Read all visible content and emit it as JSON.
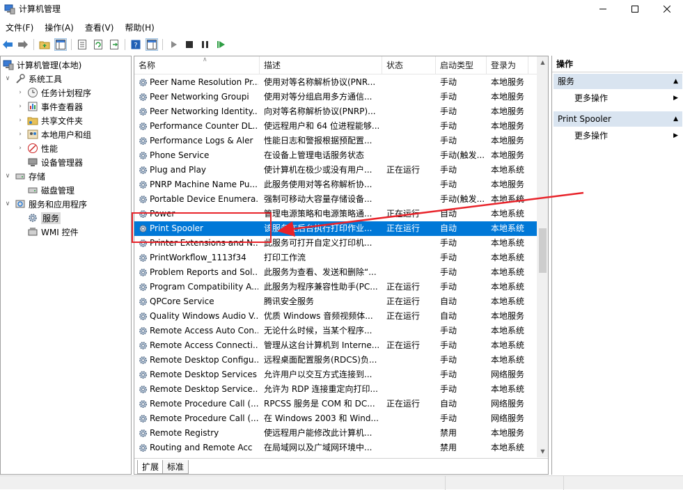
{
  "window": {
    "title": "计算机管理",
    "buttons": {
      "minimize": "minimize-icon",
      "maximize": "maximize-icon",
      "close": "close-icon"
    }
  },
  "menu": [
    "文件(F)",
    "操作(A)",
    "查看(V)",
    "帮助(H)"
  ],
  "toolbar": {
    "icons": [
      "back-arrow-icon",
      "forward-arrow-icon",
      "up-folder-icon",
      "show-hide-tree-icon",
      "properties-icon",
      "refresh-icon",
      "export-list-icon",
      "help-icon",
      "view-icon",
      "start-service-icon",
      "stop-service-icon",
      "pause-service-icon",
      "restart-service-icon"
    ]
  },
  "tree": {
    "items": [
      {
        "label": "计算机管理(本地)",
        "level": 0,
        "expander": "",
        "icon": "computer-management-icon"
      },
      {
        "label": "系统工具",
        "level": 1,
        "expander": "v",
        "icon": "system-tools-icon"
      },
      {
        "label": "任务计划程序",
        "level": 2,
        "expander": ">",
        "icon": "clock-icon"
      },
      {
        "label": "事件查看器",
        "level": 2,
        "expander": ">",
        "icon": "event-viewer-icon"
      },
      {
        "label": "共享文件夹",
        "level": 2,
        "expander": ">",
        "icon": "shared-folder-icon"
      },
      {
        "label": "本地用户和组",
        "level": 2,
        "expander": ">",
        "icon": "users-icon"
      },
      {
        "label": "性能",
        "level": 2,
        "expander": ">",
        "icon": "performance-icon"
      },
      {
        "label": "设备管理器",
        "level": 2,
        "expander": "",
        "icon": "device-manager-icon"
      },
      {
        "label": "存储",
        "level": 1,
        "expander": "v",
        "icon": "storage-icon"
      },
      {
        "label": "磁盘管理",
        "level": 2,
        "expander": "",
        "icon": "disk-icon"
      },
      {
        "label": "服务和应用程序",
        "level": 1,
        "expander": "v",
        "icon": "services-apps-icon"
      },
      {
        "label": "服务",
        "level": 2,
        "expander": "",
        "icon": "services-gear-icon",
        "selected": true
      },
      {
        "label": "WMI 控件",
        "level": 2,
        "expander": "",
        "icon": "wmi-icon"
      }
    ]
  },
  "list": {
    "columns": [
      "名称",
      "描述",
      "状态",
      "启动类型",
      "登录为"
    ],
    "rows": [
      {
        "name": "Peer Name Resolution Pr...",
        "desc": "使用对等名称解析协议(PNR...",
        "status": "",
        "startup": "手动",
        "logon": "本地服务"
      },
      {
        "name": "Peer Networking Groupi",
        "desc": "使用对等分组启用多方通信...",
        "status": "",
        "startup": "手动",
        "logon": "本地服务"
      },
      {
        "name": "Peer Networking Identity...",
        "desc": "向对等名称解析协议(PNRP)...",
        "status": "",
        "startup": "手动",
        "logon": "本地服务"
      },
      {
        "name": "Performance Counter DL...",
        "desc": "使远程用户和 64 位进程能够...",
        "status": "",
        "startup": "手动",
        "logon": "本地服务"
      },
      {
        "name": "Performance Logs & Aler",
        "desc": "性能日志和警报根据预配置...",
        "status": "",
        "startup": "手动",
        "logon": "本地服务"
      },
      {
        "name": "Phone Service",
        "desc": "在设备上管理电话服务状态",
        "status": "",
        "startup": "手动(触发...",
        "logon": "本地服务"
      },
      {
        "name": "Plug and Play",
        "desc": "使计算机在极少或没有用户...",
        "status": "正在运行",
        "startup": "手动",
        "logon": "本地系统"
      },
      {
        "name": "PNRP Machine Name Pu...",
        "desc": "此服务使用对等名称解析协...",
        "status": "",
        "startup": "手动",
        "logon": "本地服务"
      },
      {
        "name": "Portable Device Enumera...",
        "desc": "强制可移动大容量存储设备...",
        "status": "",
        "startup": "手动(触发...",
        "logon": "本地系统"
      },
      {
        "name": "Power",
        "desc": "管理电源策略和电源策略通...",
        "status": "正在运行",
        "startup": "自动",
        "logon": "本地系统"
      },
      {
        "name": "Print Spooler",
        "desc": "该服务在后台执行打印作业...",
        "status": "正在运行",
        "startup": "自动",
        "logon": "本地系统",
        "selected": true
      },
      {
        "name": "Printer Extensions and N...",
        "desc": "此服务可打开自定义打印机...",
        "status": "",
        "startup": "手动",
        "logon": "本地系统"
      },
      {
        "name": "PrintWorkflow_1113f34",
        "desc": "打印工作流",
        "status": "",
        "startup": "手动",
        "logon": "本地系统"
      },
      {
        "name": "Problem Reports and Sol...",
        "desc": "此服务为查看、发送和删除“...",
        "status": "",
        "startup": "手动",
        "logon": "本地系统"
      },
      {
        "name": "Program Compatibility A...",
        "desc": "此服务为程序兼容性助手(PC...",
        "status": "正在运行",
        "startup": "手动",
        "logon": "本地系统"
      },
      {
        "name": "QPCore Service",
        "desc": "腾讯安全服务",
        "status": "正在运行",
        "startup": "自动",
        "logon": "本地系统"
      },
      {
        "name": "Quality Windows Audio V...",
        "desc": "优质 Windows 音频视频体...",
        "status": "正在运行",
        "startup": "自动",
        "logon": "本地服务"
      },
      {
        "name": "Remote Access Auto Con...",
        "desc": "无论什么时候，当某个程序...",
        "status": "",
        "startup": "手动",
        "logon": "本地系统"
      },
      {
        "name": "Remote Access Connecti...",
        "desc": "管理从这台计算机到 Interne...",
        "status": "正在运行",
        "startup": "手动",
        "logon": "本地系统"
      },
      {
        "name": "Remote Desktop Configu...",
        "desc": "远程桌面配置服务(RDCS)负...",
        "status": "",
        "startup": "手动",
        "logon": "本地系统"
      },
      {
        "name": "Remote Desktop Services",
        "desc": "允许用户以交互方式连接到...",
        "status": "",
        "startup": "手动",
        "logon": "网络服务"
      },
      {
        "name": "Remote Desktop Service...",
        "desc": "允许为 RDP 连接重定向打印...",
        "status": "",
        "startup": "手动",
        "logon": "本地系统"
      },
      {
        "name": "Remote Procedure Call (...",
        "desc": "RPCSS 服务是 COM 和 DC...",
        "status": "正在运行",
        "startup": "自动",
        "logon": "网络服务"
      },
      {
        "name": "Remote Procedure Call (...",
        "desc": "在 Windows 2003 和 Wind...",
        "status": "",
        "startup": "手动",
        "logon": "网络服务"
      },
      {
        "name": "Remote Registry",
        "desc": "使远程用户能修改此计算机...",
        "status": "",
        "startup": "禁用",
        "logon": "本地服务"
      },
      {
        "name": "Routing and Remote Acc",
        "desc": "在局域网以及广域网环境中...",
        "status": "",
        "startup": "禁用",
        "logon": "本地系统"
      }
    ]
  },
  "tabs": [
    "扩展",
    "标准"
  ],
  "actions": {
    "title": "操作",
    "sections": [
      {
        "label": "服务",
        "items": [
          "更多操作"
        ]
      },
      {
        "label": "Print Spooler",
        "items": [
          "更多操作"
        ]
      }
    ]
  },
  "colors": {
    "selection": "#0078d7",
    "annotation": "#e8232a",
    "action_header": "#d9e4f0"
  }
}
